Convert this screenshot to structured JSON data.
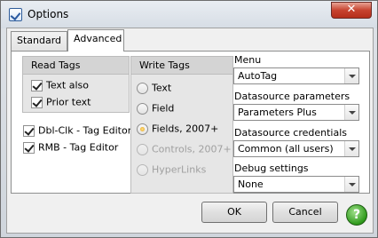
{
  "window": {
    "title": "Options",
    "close_label": "✕"
  },
  "tabs": [
    {
      "label": "Standard"
    },
    {
      "label": "Advanced"
    }
  ],
  "read_tags": {
    "title": "Read Tags",
    "options": [
      {
        "label": "Text also",
        "checked": true
      },
      {
        "label": "Prior text",
        "checked": true
      }
    ]
  },
  "extra_options": [
    {
      "label": "Dbl-Clk - Tag Editor",
      "checked": true
    },
    {
      "label": "RMB - Tag Editor",
      "checked": true
    }
  ],
  "write_tags": {
    "title": "Write Tags",
    "options": [
      {
        "label": "Text",
        "selected": false,
        "enabled": true
      },
      {
        "label": "Field",
        "selected": false,
        "enabled": true
      },
      {
        "label": "Fields, 2007+",
        "selected": true,
        "enabled": true
      },
      {
        "label": "Controls, 2007+",
        "selected": false,
        "enabled": false
      },
      {
        "label": "HyperLinks",
        "selected": false,
        "enabled": false
      }
    ]
  },
  "settings": [
    {
      "label": "Menu",
      "value": "AutoTag"
    },
    {
      "label": "Datasource parameters",
      "value": "Parameters Plus"
    },
    {
      "label": "Datasource credentials",
      "value": "Common (all users)"
    },
    {
      "label": "Debug settings",
      "value": "None"
    }
  ],
  "buttons": {
    "ok": "OK",
    "cancel": "Cancel",
    "help": "?"
  }
}
